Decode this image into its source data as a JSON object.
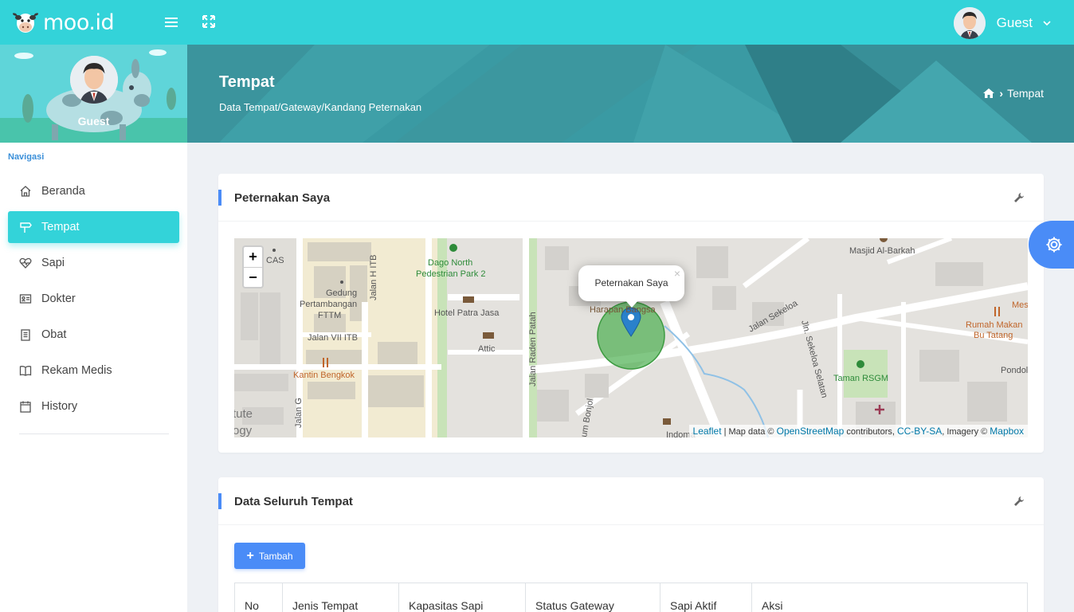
{
  "app": {
    "brand": "moo.id"
  },
  "topbar": {
    "user_name": "Guest"
  },
  "sidebar": {
    "profile_name": "Guest",
    "caption": "Navigasi",
    "items": [
      {
        "label": "Beranda",
        "icon": "home-icon"
      },
      {
        "label": "Tempat",
        "icon": "signpost-icon",
        "active": true
      },
      {
        "label": "Sapi",
        "icon": "heart-pulse-icon"
      },
      {
        "label": "Dokter",
        "icon": "id-card-icon"
      },
      {
        "label": "Obat",
        "icon": "clipboard-icon"
      },
      {
        "label": "Rekam Medis",
        "icon": "book-icon"
      },
      {
        "label": "History",
        "icon": "calendar-icon"
      }
    ]
  },
  "header": {
    "title": "Tempat",
    "subtitle": "Data Tempat/Gateway/Kandang Peternakan",
    "breadcrumb": "Tempat"
  },
  "card_map": {
    "title": "Peternakan Saya",
    "zoom_in": "+",
    "zoom_out": "−",
    "popup_text": "Peternakan Saya",
    "popup_close": "×",
    "labels": {
      "cas": "CAS",
      "dago": "Dago North",
      "dago2": "Pedestrian Park 2",
      "gedung1": "Gedung",
      "gedung2": "Pertambangan",
      "gedung3": "FTTM",
      "jalanh": "Jalan H ITB",
      "jalan7": "Jalan VII ITB",
      "kantin": "Kantin Bengkok",
      "patra": "Hotel Patra Jasa",
      "attic": "Attic",
      "radenpatah": "Jalan Raden Patah",
      "harapan": "Harapan Bangsa",
      "masjid": "Masjid Al-Barkah",
      "sekeloa": "Jalan Sekeloa",
      "sekeloaselatan": "Jln. Sekeloa Selatan",
      "rumahmakan1": "Rumah Makan",
      "rumahmakan2": "Bu Tatang",
      "mes": "Mes",
      "pondok": "Pondol",
      "taman": "Taman RSGM",
      "tute": "tute",
      "ogy": "ogy",
      "jalang": "Jalan G",
      "bonjol": "um Bonjol",
      "indoma": "Indoma"
    },
    "attribution": {
      "leaflet": "Leaflet",
      "mapdata": " | Map data © ",
      "osm": "OpenStreetMap",
      "contrib": " contributors, ",
      "ccbysa": "CC-BY-SA",
      "imagery": ", Imagery © ",
      "mapbox": "Mapbox"
    },
    "colors": {
      "marker": "#2a81cb",
      "circle": "#4caf50"
    }
  },
  "card_table": {
    "title": "Data Seluruh Tempat",
    "add_button": "Tambah",
    "columns": [
      "No",
      "Jenis Tempat",
      "Kapasitas Sapi",
      "Status Gateway",
      "Sapi Aktif",
      "Aksi"
    ]
  },
  "colors": {
    "primary": "#33d3d9",
    "accent": "#4a8cf7",
    "header": "#3a9aa3"
  }
}
